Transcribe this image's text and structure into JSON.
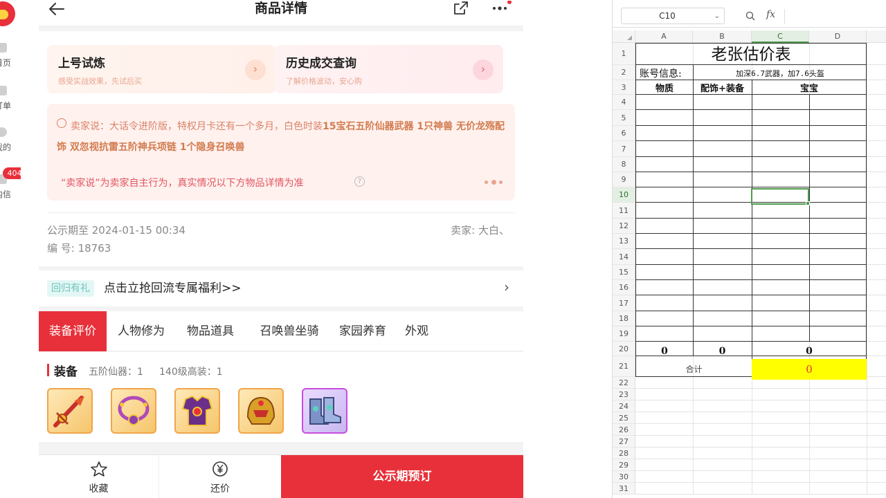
{
  "left_nav": {
    "items": [
      {
        "label": "首页"
      },
      {
        "label": "订单"
      },
      {
        "label": "我的"
      },
      {
        "label": "站内信",
        "badge": "404"
      }
    ]
  },
  "header": {
    "title": "商品详情"
  },
  "quick_actions": [
    {
      "title": "上号试炼",
      "subtitle": "感受实战效果，先试后买"
    },
    {
      "title": "历史成交查询",
      "subtitle": "了解价格波动，安心购"
    }
  ],
  "seller_says": {
    "prefix": "卖家说：大话令进阶版，特权月卡还有一个多月，白色时装",
    "highlight": "15宝石五阶仙器武器 1只神兽 无价龙殇配饰 双忽视抗雷五阶神兵项链 1个隐身召唤兽",
    "note": "“卖家说”为卖家自主行为，真实情况以下方物品详情为准"
  },
  "meta": {
    "publicity": "公示期至 2024-01-15 00:34",
    "seller": "卖家: 大白、",
    "serial": "编 号: 18763"
  },
  "promo": {
    "tag": "回归有礼",
    "text": "点击立抢回流专属福利>>"
  },
  "tabs": [
    {
      "label": "装备评价",
      "active": true
    },
    {
      "label": "人物修为",
      "active": false
    },
    {
      "label": "物品道具",
      "active": false
    },
    {
      "label": "召唤兽坐骑",
      "active": false
    },
    {
      "label": "家园养育",
      "active": false
    },
    {
      "label": "外观",
      "active": false
    }
  ],
  "equipment": {
    "title": "装备",
    "stat1": "五阶仙器：1",
    "stat2": "140级高装：1",
    "items": [
      {
        "icon": "sword-icon",
        "rarity": "gold"
      },
      {
        "icon": "necklace-icon",
        "rarity": "gold"
      },
      {
        "icon": "armor-icon",
        "rarity": "gold"
      },
      {
        "icon": "helmet-icon",
        "rarity": "gold"
      },
      {
        "icon": "boots-icon",
        "rarity": "purple"
      }
    ]
  },
  "footer": {
    "favorite": "收藏",
    "bargain": "还价",
    "reserve": "公示期预订"
  },
  "sheet": {
    "name_box": "C10",
    "columns": [
      "A",
      "B",
      "C",
      "D"
    ],
    "selected_column": "C",
    "selected_row": 10,
    "rows": [
      "1",
      "2",
      "3",
      "4",
      "5",
      "6",
      "7",
      "8",
      "9",
      "10",
      "11",
      "12",
      "13",
      "14",
      "15",
      "16",
      "17",
      "18",
      "19",
      "20",
      "21",
      "22",
      "23",
      "24",
      "25",
      "26",
      "27",
      "28",
      "29",
      "30",
      "31"
    ],
    "title": "老张估价表",
    "account_label": "账号信息:",
    "account_value": "加深6.7武器，加7.6头盔",
    "headers": [
      "物质",
      "配饰+装备",
      "宝宝"
    ],
    "row20": [
      "0",
      "0",
      "0"
    ],
    "total_label": "合计",
    "total_value": "0",
    "colors": {
      "total_fill": "#ffff00",
      "total_text": "#e8303a",
      "selection": "#4d9b4d"
    }
  },
  "colors": {
    "brand_red": "#e8303a",
    "seller_text": "#d9836a"
  }
}
